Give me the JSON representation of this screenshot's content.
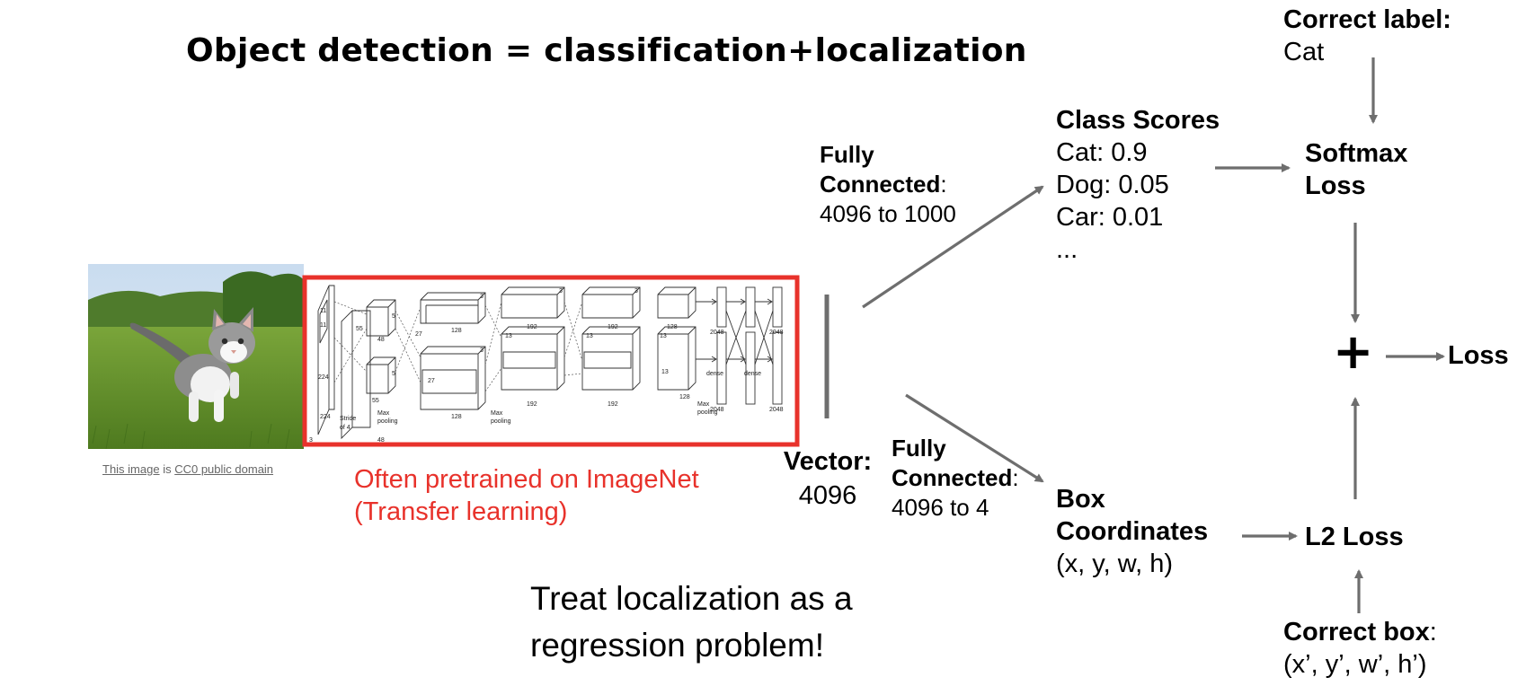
{
  "title": "Object detection = classification+localization",
  "image_caption": {
    "link1": "This image",
    "middle": " is ",
    "link2": "CC0 public domain"
  },
  "pretrain_note": [
    "Often pretrained on ImageNet",
    "(Transfer learning)"
  ],
  "vector": {
    "label": "Vector:",
    "value": "4096"
  },
  "fc_top": {
    "line1": "Fully",
    "line2": "Connected",
    "colon": ":",
    "line3": "4096 to 1000"
  },
  "fc_bottom": {
    "line1": "Fully",
    "line2": "Connected",
    "colon": ":",
    "line3": "4096 to 4"
  },
  "class_scores": {
    "heading": "Class Scores",
    "items": [
      "Cat: 0.9",
      "Dog: 0.05",
      "Car: 0.01",
      "..."
    ]
  },
  "correct_label": {
    "heading": "Correct label:",
    "value": "Cat"
  },
  "softmax": {
    "line1": "Softmax",
    "line2": "Loss"
  },
  "plus_symbol": "+",
  "loss_label": "Loss",
  "box_coords": {
    "line1": "Box",
    "line2": "Coordinates",
    "line3": "(x, y, w, h)"
  },
  "l2_loss": "L2 Loss",
  "correct_box": {
    "heading": "Correct box",
    "colon": ":",
    "value": "(x’, y’, w’, h’)"
  },
  "treat_note": [
    "Treat localization as a",
    "regression problem!"
  ],
  "cnn_labels": {
    "n224a": "224",
    "n224b": "224",
    "n3": "3",
    "n11a": "11",
    "n11b": "11",
    "stride": "Stride",
    "of4": "of 4",
    "n55a": "55",
    "n55b": "55",
    "n5a": "5",
    "n5b": "5",
    "n48a": "48",
    "n48b": "48",
    "n27a": "27",
    "n27b": "27",
    "n128a": "128",
    "n128b": "128",
    "n3a": "3",
    "n3b": "3",
    "n3c": "3",
    "n3d": "3",
    "n192a": "192",
    "n192b": "192",
    "n192c": "192",
    "n192d": "192",
    "n13a": "13",
    "n13b": "13",
    "n13c": "13",
    "n13d": "13",
    "n128c": "128",
    "n128d": "128",
    "n2048a": "2048",
    "n2048b": "2048",
    "n2048c": "2048",
    "n2048d": "2048",
    "dense1": "dense",
    "dense2": "dense",
    "maxpool1": "Max",
    "maxpool1b": "pooling",
    "maxpool2": "Max",
    "maxpool2b": "pooling",
    "maxpool3": "Max",
    "maxpool3b": "pooling"
  },
  "colors": {
    "red_box": "#e8322b",
    "arrow": "#6e6e6e",
    "note_red": "#e8322b"
  }
}
